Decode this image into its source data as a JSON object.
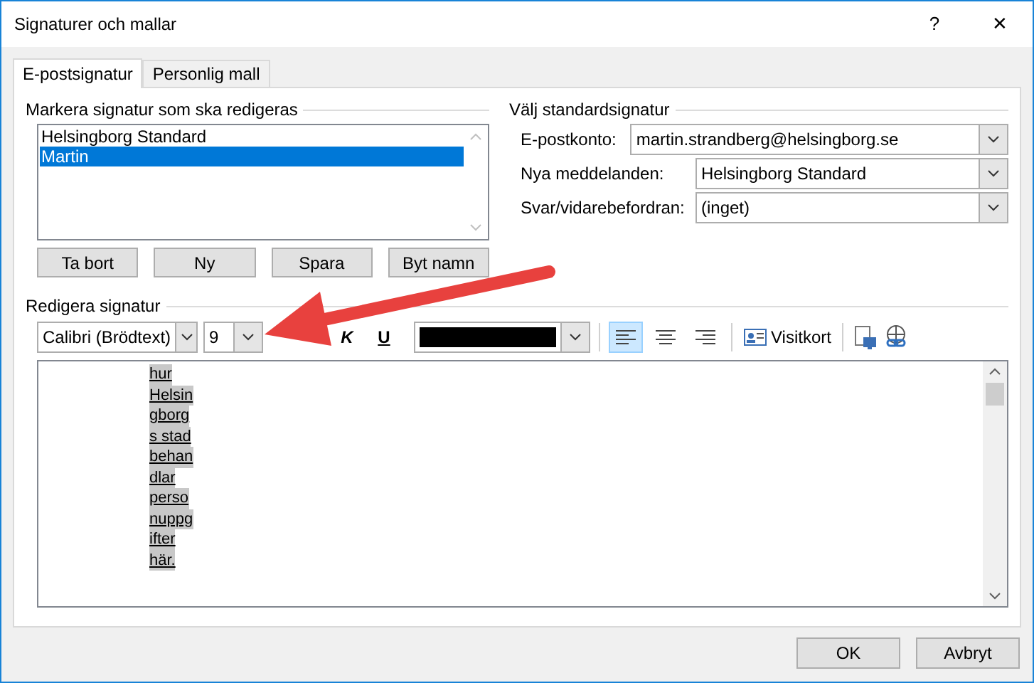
{
  "window": {
    "title": "Signaturer och mallar",
    "help": "?",
    "close": "✕"
  },
  "tabs": [
    {
      "label": "E-postsignatur",
      "selected": true
    },
    {
      "label": "Personlig mall",
      "selected": false
    }
  ],
  "signature_list": {
    "heading": "Markera signatur som ska redigeras",
    "items": [
      {
        "label": "Helsingborg Standard",
        "selected": false
      },
      {
        "label": "Martin",
        "selected": true
      }
    ],
    "buttons": [
      "Ta bort",
      "Ny",
      "Spara",
      "Byt namn"
    ]
  },
  "defaults": {
    "heading": "Välj standardsignatur",
    "fields": [
      {
        "label": "E-postkonto:",
        "value": "martin.strandberg@helsingborg.se"
      },
      {
        "label": "Nya meddelanden:",
        "value": "Helsingborg Standard"
      },
      {
        "label": "Svar/vidarebefordran:",
        "value": "(inget)"
      }
    ]
  },
  "editor": {
    "heading": "Redigera signatur",
    "font": "Calibri (Brödtext)",
    "size": "9",
    "italic": "K",
    "underline": "U",
    "business_card": "Visitkort",
    "align": [
      {
        "kind": "left",
        "selected": true
      },
      {
        "kind": "center",
        "selected": false
      },
      {
        "kind": "right",
        "selected": false
      }
    ],
    "lines": [
      "hur",
      "Helsin",
      "gborg",
      "s stad",
      "behan",
      "dlar",
      "perso",
      "nuppg",
      "ifter",
      "här."
    ]
  },
  "buttons": [
    "OK",
    "Avbryt"
  ]
}
